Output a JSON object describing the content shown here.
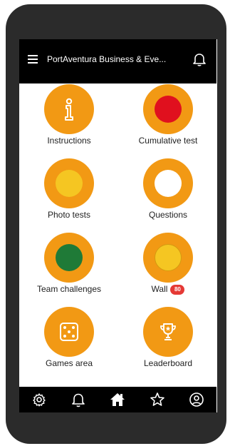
{
  "app": {
    "title": "PortAventura Business & Eve..."
  },
  "colors": {
    "header_bg": "#000000",
    "tile_orange": "#f29914",
    "red": "#e0101e",
    "yellow": "#f5c622",
    "green": "#1f7a37",
    "badge_red": "#e53935"
  },
  "tiles": [
    {
      "label": "Instructions",
      "icon": "info-icon"
    },
    {
      "label": "Cumulative test",
      "icon": "red-dot"
    },
    {
      "label": "Photo tests",
      "icon": "yellow-dot"
    },
    {
      "label": "Questions",
      "icon": "white-dot"
    },
    {
      "label": "Team challenges",
      "icon": "green-dot"
    },
    {
      "label": "Wall",
      "icon": "yellow-dot",
      "badge": "80"
    },
    {
      "label": "Games area",
      "icon": "dice-icon"
    },
    {
      "label": "Leaderboard",
      "icon": "trophy-icon"
    }
  ],
  "bottom_nav": [
    "settings-icon",
    "bell-icon",
    "home-icon",
    "star-icon",
    "profile-icon"
  ]
}
